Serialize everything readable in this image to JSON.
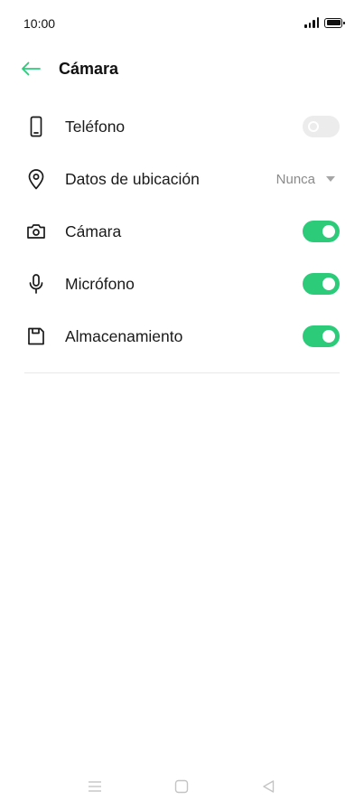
{
  "status_bar": {
    "time": "10:00"
  },
  "header": {
    "title": "Cámara"
  },
  "permissions": [
    {
      "label": "Teléfono",
      "icon": "phone-icon",
      "control": "toggle",
      "on": false
    },
    {
      "label": "Datos de ubicación",
      "icon": "location-pin-icon",
      "control": "dropdown",
      "value": "Nunca"
    },
    {
      "label": "Cámara",
      "icon": "camera-icon",
      "control": "toggle",
      "on": true
    },
    {
      "label": "Micrófono",
      "icon": "microphone-icon",
      "control": "toggle",
      "on": true
    },
    {
      "label": "Almacenamiento",
      "icon": "storage-icon",
      "control": "toggle",
      "on": true
    }
  ],
  "colors": {
    "accent": "#2bcb7a",
    "toggle_off": "#ececec",
    "back_arrow": "#2bcb7a"
  },
  "nav_bar": {
    "buttons": [
      "menu-icon",
      "home-icon",
      "back-triangle-icon"
    ]
  }
}
